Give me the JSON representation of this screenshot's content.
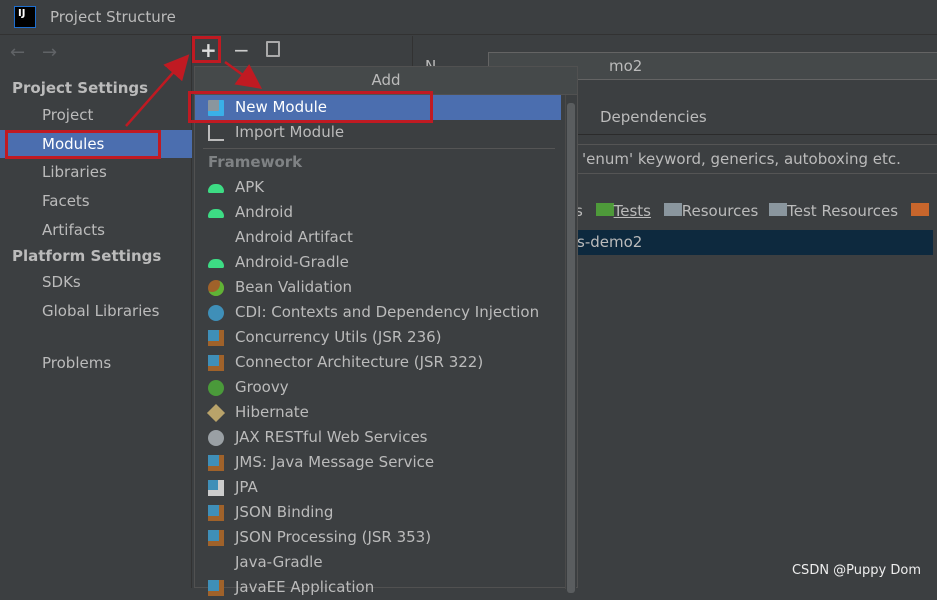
{
  "window": {
    "title": "Project Structure",
    "app_icon": "IJ"
  },
  "toolbar": {
    "back": "←",
    "forward": "→",
    "add": "+",
    "remove": "−",
    "copy": "copy-icon"
  },
  "sidebar": {
    "project_settings": "Project Settings",
    "project_items": [
      {
        "label": "Project"
      },
      {
        "label": "Modules",
        "selected": true
      },
      {
        "label": "Libraries"
      },
      {
        "label": "Facets"
      },
      {
        "label": "Artifacts"
      }
    ],
    "platform_settings": "Platform Settings",
    "platform_items": [
      {
        "label": "SDKs"
      },
      {
        "label": "Global Libraries"
      }
    ],
    "problems": "Problems"
  },
  "right": {
    "name_label": "N",
    "name_value": "mo2",
    "tab": "Dependencies",
    "language_level": "'enum' keyword, generics, autoboxing etc.",
    "markers": [
      "s",
      "Tests",
      "Resources",
      "Test Resources"
    ],
    "content_root": "s-demo2"
  },
  "popup": {
    "title": "Add",
    "top_items": [
      {
        "label": "New Module",
        "icon": "new-module-icon"
      },
      {
        "label": "Import Module",
        "icon": "import-module-icon"
      }
    ],
    "section": "Framework",
    "frameworks": [
      {
        "label": "APK",
        "icon": "android"
      },
      {
        "label": "Android",
        "icon": "android"
      },
      {
        "label": "Android Artifact",
        "icon": ""
      },
      {
        "label": "Android-Gradle",
        "icon": "android"
      },
      {
        "label": "Bean Validation",
        "icon": "bean"
      },
      {
        "label": "CDI: Contexts and Dependency Injection",
        "icon": "cdi"
      },
      {
        "label": "Concurrency Utils (JSR 236)",
        "icon": "javaee"
      },
      {
        "label": "Connector Architecture (JSR 322)",
        "icon": "javaee"
      },
      {
        "label": "Groovy",
        "icon": "groovy"
      },
      {
        "label": "Hibernate",
        "icon": "hibernate"
      },
      {
        "label": "JAX RESTful Web Services",
        "icon": "globe"
      },
      {
        "label": "JMS: Java Message Service",
        "icon": "javaee"
      },
      {
        "label": "JPA",
        "icon": "jpa"
      },
      {
        "label": "JSON Binding",
        "icon": "javaee"
      },
      {
        "label": "JSON Processing (JSR 353)",
        "icon": "javaee"
      },
      {
        "label": "Java-Gradle",
        "icon": ""
      },
      {
        "label": "JavaEE Application",
        "icon": "javaee"
      }
    ]
  },
  "colors": {
    "selection": "#4b6eaf",
    "annotation": "#c01a22",
    "background": "#3c3f41"
  },
  "watermark": "CSDN @Puppy Dom"
}
